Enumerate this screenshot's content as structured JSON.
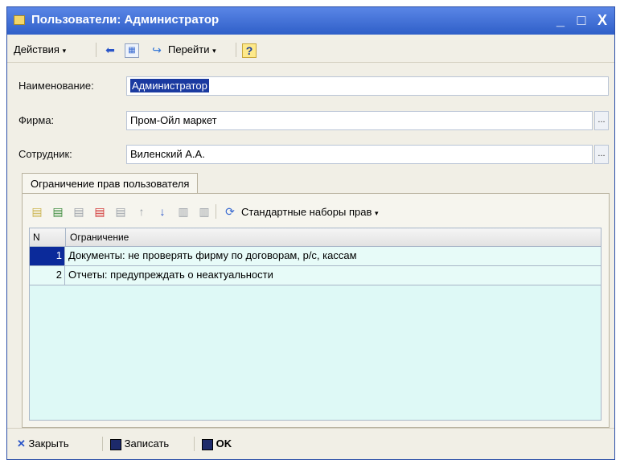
{
  "window": {
    "title": "Пользователи: Администратор",
    "controls": [
      "_",
      "□",
      "X"
    ]
  },
  "toolbar": {
    "actions_label": "Действия",
    "goto_label": "Перейти",
    "help_label": "?"
  },
  "form": {
    "name_label": "Наименование:",
    "name_value": "Администратор",
    "firm_label": "Фирма:",
    "firm_value": "Пром-Ойл маркет",
    "employee_label": "Сотрудник:",
    "employee_value": "Виленский А.А.",
    "select_btn": "..."
  },
  "tab": {
    "label": "Ограничение прав пользователя"
  },
  "inner_toolbar": {
    "std_sets_label": "Стандартные наборы прав"
  },
  "grid": {
    "columns": [
      "N",
      "Ограничение"
    ],
    "rows": [
      {
        "n": "1",
        "text": "Документы: не проверять фирму по договорам, р/с, кассам"
      },
      {
        "n": "2",
        "text": "Отчеты: предупреждать о неактуальности"
      }
    ]
  },
  "footer": {
    "close_label": "Закрыть",
    "save_label": "Записать",
    "ok_label": "OK"
  },
  "colors": {
    "title_bg": "#2f5fc8",
    "grid_bg": "#def9f6",
    "selection": "#0b2a9a"
  }
}
